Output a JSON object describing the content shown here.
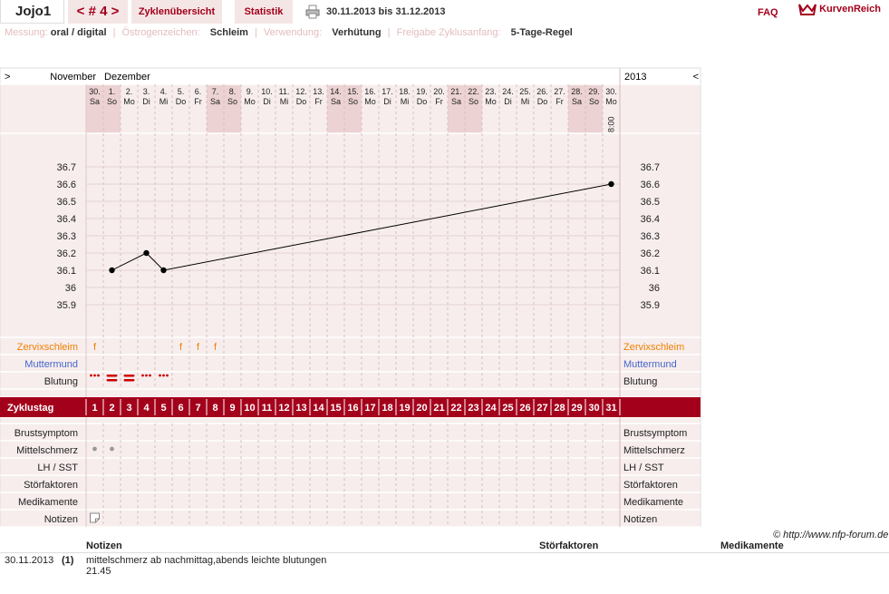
{
  "header": {
    "title": "Jojo1",
    "cycle_nav": "< # 4 >",
    "tab_overview": "Zyklenübersicht",
    "tab_stats": "Statistik",
    "date_range": "30.11.2013 bis 31.12.2013",
    "faq": "FAQ",
    "logo": "KurvenReich"
  },
  "meta": {
    "measure_label": "Messung:",
    "measure_value": "oral / digital",
    "sign_label": "Östrogenzeichen:",
    "sign_value": "Schleim",
    "use_label": "Verwendung:",
    "use_value": "Verhütung",
    "release_label": "Freigabe Zyklusanfang:",
    "release_value": "5-Tage-Regel"
  },
  "calendar": {
    "prev_symbol": ">",
    "next_symbol": "<",
    "month1": "November",
    "month2": "Dezember",
    "year": "2013",
    "time_label": "8:00",
    "days": [
      {
        "d": "30.",
        "w": "Sa",
        "we": true
      },
      {
        "d": "1.",
        "w": "So",
        "we": true
      },
      {
        "d": "2.",
        "w": "Mo"
      },
      {
        "d": "3.",
        "w": "Di"
      },
      {
        "d": "4.",
        "w": "Mi"
      },
      {
        "d": "5.",
        "w": "Do"
      },
      {
        "d": "6.",
        "w": "Fr"
      },
      {
        "d": "7.",
        "w": "Sa",
        "we": true
      },
      {
        "d": "8.",
        "w": "So",
        "we": true
      },
      {
        "d": "9.",
        "w": "Mo"
      },
      {
        "d": "10.",
        "w": "Di"
      },
      {
        "d": "11.",
        "w": "Mi"
      },
      {
        "d": "12.",
        "w": "Do"
      },
      {
        "d": "13.",
        "w": "Fr"
      },
      {
        "d": "14.",
        "w": "Sa",
        "we": true
      },
      {
        "d": "15.",
        "w": "So",
        "we": true
      },
      {
        "d": "16.",
        "w": "Mo"
      },
      {
        "d": "17.",
        "w": "Di"
      },
      {
        "d": "18.",
        "w": "Mi"
      },
      {
        "d": "19.",
        "w": "Do"
      },
      {
        "d": "20.",
        "w": "Fr"
      },
      {
        "d": "21.",
        "w": "Sa",
        "we": true
      },
      {
        "d": "22.",
        "w": "So",
        "we": true
      },
      {
        "d": "23.",
        "w": "Mo"
      },
      {
        "d": "24.",
        "w": "Di"
      },
      {
        "d": "25.",
        "w": "Mi"
      },
      {
        "d": "26.",
        "w": "Do"
      },
      {
        "d": "27.",
        "w": "Fr"
      },
      {
        "d": "28.",
        "w": "Sa",
        "we": true
      },
      {
        "d": "29.",
        "w": "So",
        "we": true
      },
      {
        "d": "30.",
        "w": "Mo"
      }
    ]
  },
  "chart_data": {
    "type": "line",
    "x": [
      2,
      4,
      5,
      31
    ],
    "y": [
      36.1,
      36.2,
      36.1,
      36.6
    ],
    "yticks": [
      "36.7",
      "36.6",
      "36.5",
      "36.4",
      "36.3",
      "36.2",
      "36.1",
      "36",
      "35.9"
    ],
    "ylim": [
      35.9,
      36.7
    ],
    "xlim": [
      1,
      31
    ],
    "grid": true,
    "line_color": "#000000"
  },
  "rows": {
    "cervix_label": "Zervixschleim",
    "cervix_color": "#f08000",
    "cervix_marks": [
      {
        "day": 1,
        "t": "f"
      },
      {
        "day": 6,
        "t": "f"
      },
      {
        "day": 7,
        "t": "f"
      },
      {
        "day": 8,
        "t": "f"
      }
    ],
    "cervix_mark_color": "#f08000",
    "mm_label": "Muttermund",
    "mm_color": "#4466cc",
    "bleeding_label": "Blutung",
    "bleeding": [
      {
        "day": 1,
        "kind": "dots"
      },
      {
        "day": 2,
        "kind": "bars"
      },
      {
        "day": 3,
        "kind": "bars"
      },
      {
        "day": 4,
        "kind": "dots"
      },
      {
        "day": 5,
        "kind": "dots"
      }
    ],
    "cycle_label": "Zyklustag",
    "cycle_days": [
      "1",
      "2",
      "3",
      "4",
      "5",
      "6",
      "7",
      "8",
      "9",
      "10",
      "11",
      "12",
      "13",
      "14",
      "15",
      "16",
      "17",
      "18",
      "19",
      "20",
      "21",
      "22",
      "23",
      "24",
      "25",
      "26",
      "27",
      "28",
      "29",
      "30",
      "31"
    ],
    "cycle_color": "#a3001b",
    "breast_label": "Brustsymptom",
    "mittel_label": "Mittelschmerz",
    "mittel_days": [
      1,
      2
    ],
    "lh_label": "LH / SST",
    "stoer_label": "Störfaktoren",
    "med_label": "Medikamente",
    "notes_label": "Notizen",
    "notes_days": [
      1
    ]
  },
  "copyright": "© http://www.nfp-forum.de",
  "notes_table": {
    "col_notes": "Notizen",
    "col_stoer": "Störfaktoren",
    "col_med": "Medikamente",
    "entries": [
      {
        "date": "30.11.2013",
        "num": "(1)",
        "text": "mittelschmerz ab nachmittag,abends leichte blutungen",
        "time": "21.45"
      }
    ]
  }
}
